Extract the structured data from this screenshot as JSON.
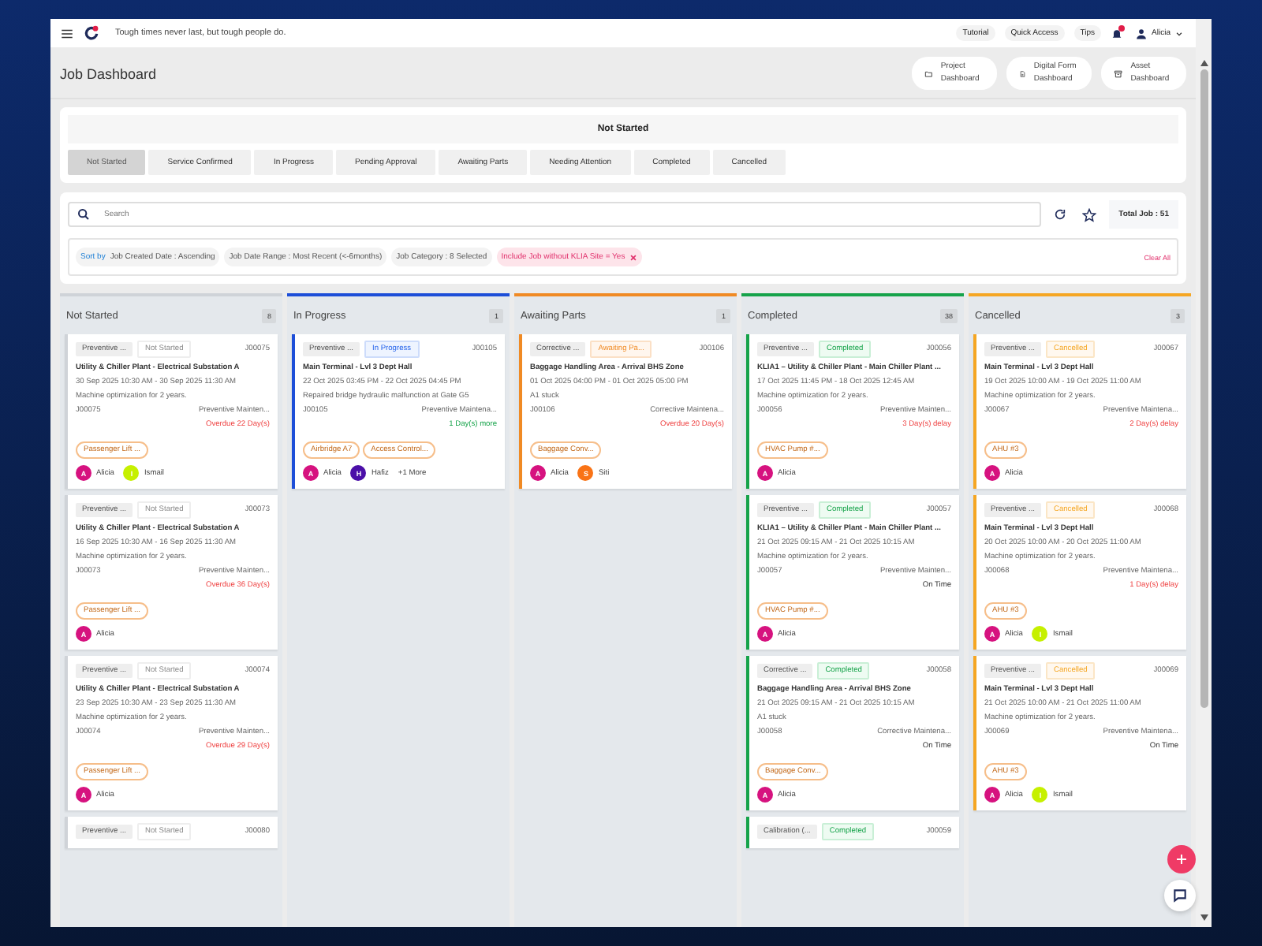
{
  "header": {
    "tagline": "Tough times never last, but tough people do.",
    "links": [
      "Tutorial",
      "Quick Access",
      "Tips"
    ],
    "notification_dot": true,
    "user": "Alicia"
  },
  "page": {
    "title": "Job Dashboard",
    "shortcuts": [
      {
        "kind": "folder",
        "label": "Project Dashboard"
      },
      {
        "kind": "form",
        "label": "Digital Form Dashboard"
      },
      {
        "kind": "archive",
        "label": "Asset Dashboard"
      }
    ]
  },
  "status_panel": {
    "heading": "Not Started",
    "tabs": [
      {
        "label": "Not Started",
        "selected": true
      },
      {
        "label": "Service Confirmed",
        "selected": false
      },
      {
        "label": "In Progress",
        "selected": false
      },
      {
        "label": "Pending Approval",
        "selected": false
      },
      {
        "label": "Awaiting Parts",
        "selected": false
      },
      {
        "label": "Needing Attention",
        "selected": false
      },
      {
        "label": "Completed",
        "selected": false
      },
      {
        "label": "Cancelled",
        "selected": false
      }
    ]
  },
  "filters": {
    "search": {
      "placeholder": "Search"
    },
    "total": "Total Job : 51",
    "chips": [
      {
        "kind": "sort",
        "prefix": "Sort by",
        "text": "Job Created Date : Ascending"
      },
      {
        "kind": "plain",
        "text": "Job Date Range : Most Recent (<-6months)"
      },
      {
        "kind": "plain",
        "text": "Job Category : 8 Selected"
      },
      {
        "kind": "active",
        "text": "Include Job without KLIA Site = Yes"
      }
    ],
    "clear": "Clear All"
  },
  "columns": [
    {
      "title": "Not Started",
      "count": "8",
      "color": "#cfd3d8",
      "cards": [
        {
          "type": "Preventive ...",
          "status": {
            "text": "Not Started",
            "kind": "not_started"
          },
          "id": "J00075",
          "title": "Utility & Chiller Plant - Electrical Substation A",
          "date": "30 Sep 2025 10:30 AM - 30 Sep 2025 11:30 AM",
          "description": "Machine optimization for 2 years.",
          "ref": "J00075",
          "category": "Preventive Mainten...",
          "due": {
            "text": "Overdue 22 Day(s)",
            "kind": "late"
          },
          "tags": [
            "Passenger Lift ..."
          ],
          "assignees": [
            {
              "initial": "A",
              "name": "Alicia",
              "color": "#d6127f"
            },
            {
              "initial": "I",
              "name": "Ismail",
              "color": "#c6f000"
            }
          ]
        },
        {
          "type": "Preventive ...",
          "status": {
            "text": "Not Started",
            "kind": "not_started"
          },
          "id": "J00073",
          "title": "Utility & Chiller Plant - Electrical Substation A",
          "date": "16 Sep 2025 10:30 AM - 16 Sep 2025 11:30 AM",
          "description": "Machine optimization for 2 years.",
          "ref": "J00073",
          "category": "Preventive Mainten...",
          "due": {
            "text": "Overdue 36 Day(s)",
            "kind": "late"
          },
          "tags": [
            "Passenger Lift ..."
          ],
          "assignees": [
            {
              "initial": "A",
              "name": "Alicia",
              "color": "#d6127f"
            }
          ]
        },
        {
          "type": "Preventive ...",
          "status": {
            "text": "Not Started",
            "kind": "not_started"
          },
          "id": "J00074",
          "title": "Utility & Chiller Plant - Electrical Substation A",
          "date": "23 Sep 2025 10:30 AM - 23 Sep 2025 11:30 AM",
          "description": "Machine optimization for 2 years.",
          "ref": "J00074",
          "category": "Preventive Mainten...",
          "due": {
            "text": "Overdue 29 Day(s)",
            "kind": "late"
          },
          "tags": [
            "Passenger Lift ..."
          ],
          "assignees": [
            {
              "initial": "A",
              "name": "Alicia",
              "color": "#d6127f"
            }
          ]
        },
        {
          "type": "Preventive ...",
          "status": {
            "text": "Not Started",
            "kind": "not_started"
          },
          "id": "J00080"
        }
      ]
    },
    {
      "title": "In Progress",
      "count": "1",
      "color": "#1d4ed8",
      "cards": [
        {
          "type": "Preventive ...",
          "status": {
            "text": "In Progress",
            "kind": "in_progress"
          },
          "id": "J00105",
          "title": "Main Terminal - Lvl 3 Dept Hall",
          "date": "22 Oct 2025 03:45 PM - 22 Oct 2025 04:45 PM",
          "description": "Repaired bridge hydraulic malfunction at Gate G5",
          "ref": "J00105",
          "category": "Preventive Maintena...",
          "due": {
            "text": "1 Day(s) more",
            "kind": "ahead"
          },
          "tags": [
            "Airbridge A7",
            "Access Control..."
          ],
          "assignees": [
            {
              "initial": "A",
              "name": "Alicia",
              "color": "#d6127f"
            },
            {
              "initial": "H",
              "name": "Hafiz",
              "color": "#4b0fa8"
            }
          ],
          "more": "+1 More"
        }
      ]
    },
    {
      "title": "Awaiting Parts",
      "count": "1",
      "color": "#f08a24",
      "cards": [
        {
          "type": "Corrective ...",
          "status": {
            "text": "Awaiting Pa...",
            "kind": "awaiting"
          },
          "id": "J00106",
          "title": "Baggage Handling Area - Arrival BHS Zone",
          "date": "01 Oct 2025 04:00 PM - 01 Oct 2025 05:00 PM",
          "description": "A1 stuck",
          "ref": "J00106",
          "category": "Corrective Maintena...",
          "due": {
            "text": "Overdue 20 Day(s)",
            "kind": "late"
          },
          "tags": [
            "Baggage Conv..."
          ],
          "assignees": [
            {
              "initial": "A",
              "name": "Alicia",
              "color": "#d6127f"
            },
            {
              "initial": "S",
              "name": "Siti",
              "color": "#f97316"
            }
          ]
        }
      ]
    },
    {
      "title": "Completed",
      "count": "38",
      "color": "#16a34a",
      "cards": [
        {
          "type": "Preventive ...",
          "status": {
            "text": "Completed",
            "kind": "completed"
          },
          "id": "J00056",
          "title": "KLIA1 – Utility & Chiller Plant - Main Chiller Plant ...",
          "date": "17 Oct 2025 11:45 PM - 18 Oct 2025 12:45 AM",
          "description": "Machine optimization for 2 years.",
          "ref": "J00056",
          "category": "Preventive Mainten...",
          "due": {
            "text": "3 Day(s) delay",
            "kind": "late"
          },
          "tags": [
            "HVAC Pump #..."
          ],
          "assignees": [
            {
              "initial": "A",
              "name": "Alicia",
              "color": "#d6127f"
            }
          ]
        },
        {
          "type": "Preventive ...",
          "status": {
            "text": "Completed",
            "kind": "completed"
          },
          "id": "J00057",
          "title": "KLIA1 – Utility & Chiller Plant - Main Chiller Plant ...",
          "date": "21 Oct 2025 09:15 AM - 21 Oct 2025 10:15 AM",
          "description": "Machine optimization for 2 years.",
          "ref": "J00057",
          "category": "Preventive Mainten...",
          "due": {
            "text": "On Time",
            "kind": "on_time"
          },
          "tags": [
            "HVAC Pump #..."
          ],
          "assignees": [
            {
              "initial": "A",
              "name": "Alicia",
              "color": "#d6127f"
            }
          ]
        },
        {
          "type": "Corrective ...",
          "status": {
            "text": "Completed",
            "kind": "completed"
          },
          "id": "J00058",
          "title": "Baggage Handling Area - Arrival BHS Zone",
          "date": "21 Oct 2025 09:15 AM - 21 Oct 2025 10:15 AM",
          "description": "A1 stuck",
          "ref": "J00058",
          "category": "Corrective Maintena...",
          "due": {
            "text": "On Time",
            "kind": "on_time"
          },
          "tags": [
            "Baggage Conv..."
          ],
          "assignees": [
            {
              "initial": "A",
              "name": "Alicia",
              "color": "#d6127f"
            }
          ]
        },
        {
          "type": "Calibration (...",
          "status": {
            "text": "Completed",
            "kind": "completed"
          },
          "id": "J00059"
        }
      ]
    },
    {
      "title": "Cancelled",
      "count": "3",
      "color": "#f5a623",
      "cards": [
        {
          "type": "Preventive ...",
          "status": {
            "text": "Cancelled",
            "kind": "cancelled"
          },
          "id": "J00067",
          "title": "Main Terminal - Lvl 3 Dept Hall",
          "date": "19 Oct 2025 10:00 AM - 19 Oct 2025 11:00 AM",
          "description": "Machine optimization for 2 years.",
          "ref": "J00067",
          "category": "Preventive Maintena...",
          "due": {
            "text": "2 Day(s) delay",
            "kind": "late"
          },
          "tags": [
            "AHU #3"
          ],
          "assignees": [
            {
              "initial": "A",
              "name": "Alicia",
              "color": "#d6127f"
            }
          ]
        },
        {
          "type": "Preventive ...",
          "status": {
            "text": "Cancelled",
            "kind": "cancelled"
          },
          "id": "J00068",
          "title": "Main Terminal - Lvl 3 Dept Hall",
          "date": "20 Oct 2025 10:00 AM - 20 Oct 2025 11:00 AM",
          "description": "Machine optimization for 2 years.",
          "ref": "J00068",
          "category": "Preventive Maintena...",
          "due": {
            "text": "1 Day(s) delay",
            "kind": "late"
          },
          "tags": [
            "AHU #3"
          ],
          "assignees": [
            {
              "initial": "A",
              "name": "Alicia",
              "color": "#d6127f"
            },
            {
              "initial": "I",
              "name": "Ismail",
              "color": "#c6f000"
            }
          ]
        },
        {
          "type": "Preventive ...",
          "status": {
            "text": "Cancelled",
            "kind": "cancelled"
          },
          "id": "J00069",
          "title": "Main Terminal - Lvl 3 Dept Hall",
          "date": "21 Oct 2025 10:00 AM - 21 Oct 2025 11:00 AM",
          "description": "Machine optimization for 2 years.",
          "ref": "J00069",
          "category": "Preventive Maintena...",
          "due": {
            "text": "On Time",
            "kind": "on_time"
          },
          "tags": [
            "AHU #3"
          ],
          "assignees": [
            {
              "initial": "A",
              "name": "Alicia",
              "color": "#d6127f"
            },
            {
              "initial": "I",
              "name": "Ismail",
              "color": "#c6f000"
            }
          ]
        }
      ]
    }
  ]
}
